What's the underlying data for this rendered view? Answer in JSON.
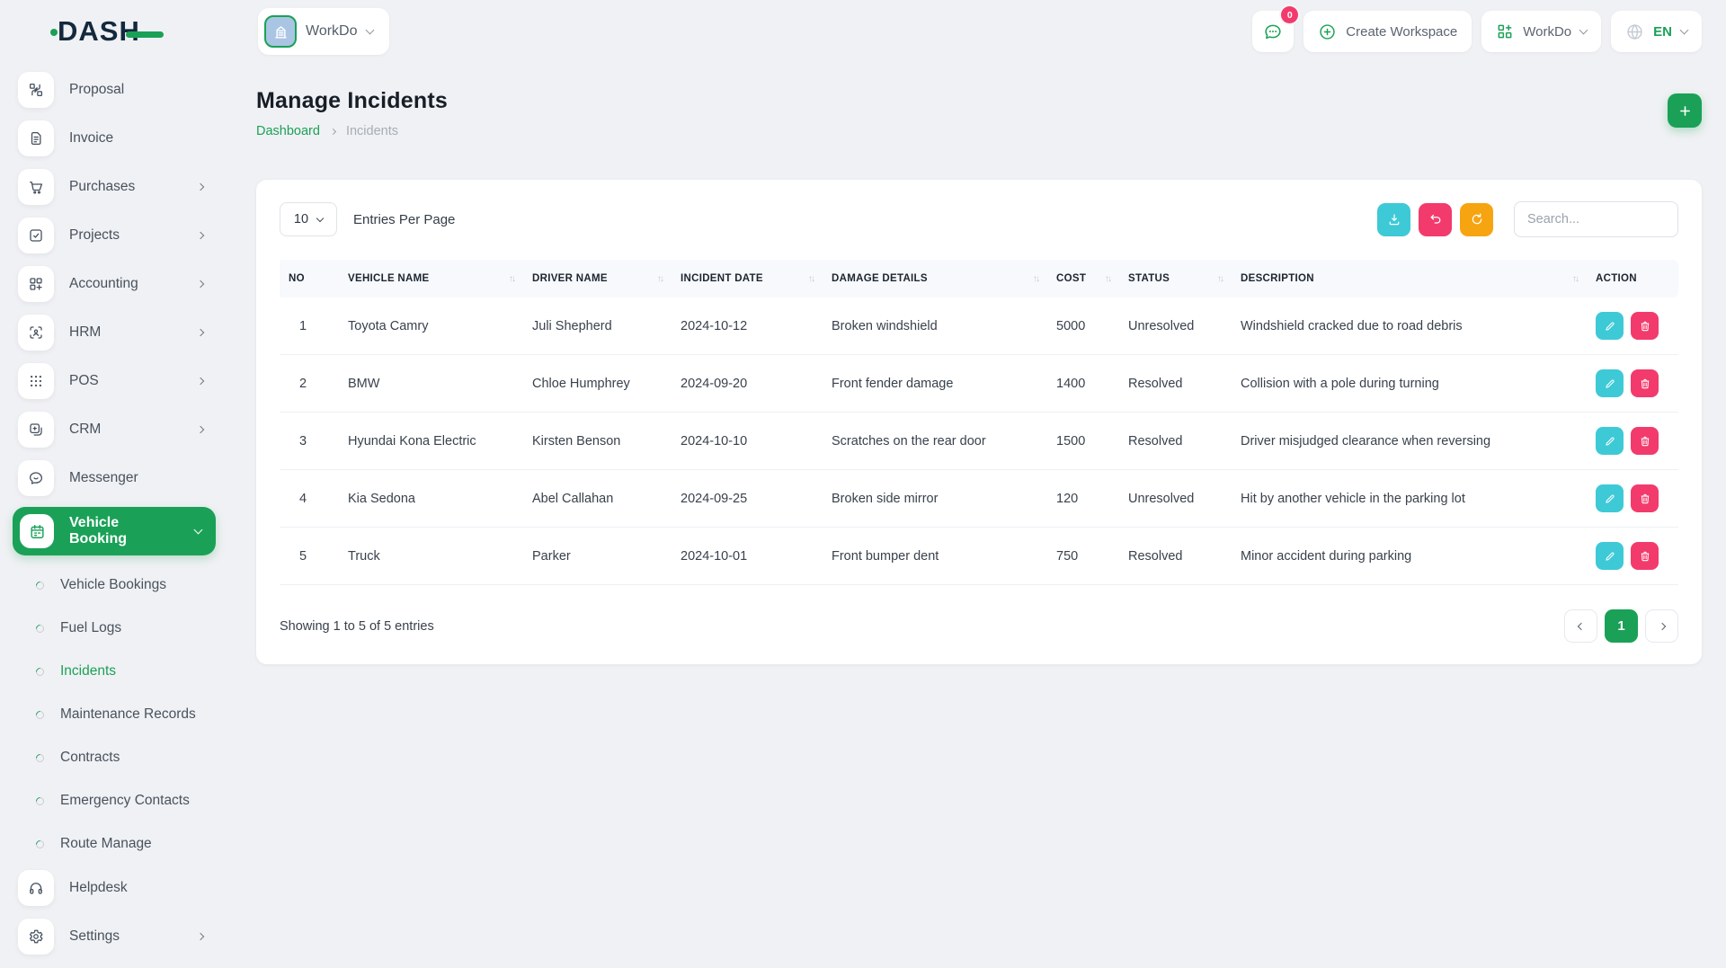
{
  "brand": {
    "name": "DASH"
  },
  "header": {
    "workspace_selector_label": "WorkDo",
    "messages_badge": "0",
    "create_workspace_label": "Create Workspace",
    "workspace_dropdown_label": "WorkDo",
    "language": "EN"
  },
  "sidebar": {
    "items": [
      {
        "label": "Proposal"
      },
      {
        "label": "Invoice"
      },
      {
        "label": "Purchases"
      },
      {
        "label": "Projects"
      },
      {
        "label": "Accounting"
      },
      {
        "label": "HRM"
      },
      {
        "label": "POS"
      },
      {
        "label": "CRM"
      },
      {
        "label": "Messenger"
      }
    ],
    "vehicle_booking_label": "Vehicle Booking",
    "submenu": [
      {
        "label": "Vehicle Bookings"
      },
      {
        "label": "Fuel Logs"
      },
      {
        "label": "Incidents",
        "active": true
      },
      {
        "label": "Maintenance Records"
      },
      {
        "label": "Contracts"
      },
      {
        "label": "Emergency Contacts"
      },
      {
        "label": "Route Manage"
      }
    ],
    "helpdesk_label": "Helpdesk",
    "settings_label": "Settings"
  },
  "page": {
    "title": "Manage Incidents",
    "breadcrumb_home": "Dashboard",
    "breadcrumb_current": "Incidents"
  },
  "toolbar": {
    "entries_per_page_value": "10",
    "entries_per_page_label": "Entries Per Page",
    "search_placeholder": "Search..."
  },
  "table": {
    "columns": [
      {
        "label": "NO",
        "sortable": false
      },
      {
        "label": "VEHICLE NAME",
        "sortable": true
      },
      {
        "label": "DRIVER NAME",
        "sortable": true
      },
      {
        "label": "INCIDENT DATE",
        "sortable": true
      },
      {
        "label": "DAMAGE DETAILS",
        "sortable": true
      },
      {
        "label": "COST",
        "sortable": true
      },
      {
        "label": "STATUS",
        "sortable": true
      },
      {
        "label": "DESCRIPTION",
        "sortable": true
      },
      {
        "label": "ACTION",
        "sortable": false
      }
    ],
    "rows": [
      {
        "no": "1",
        "vehicle": "Toyota Camry",
        "driver": "Juli Shepherd",
        "date": "2024-10-12",
        "damage": "Broken windshield",
        "cost": "5000",
        "status": "Unresolved",
        "description": "Windshield cracked due to road debris"
      },
      {
        "no": "2",
        "vehicle": "BMW",
        "driver": "Chloe Humphrey",
        "date": "2024-09-20",
        "damage": "Front fender damage",
        "cost": "1400",
        "status": "Resolved",
        "description": "Collision with a pole during turning"
      },
      {
        "no": "3",
        "vehicle": "Hyundai Kona Electric",
        "driver": "Kirsten Benson",
        "date": "2024-10-10",
        "damage": "Scratches on the rear door",
        "cost": "1500",
        "status": "Resolved",
        "description": "Driver misjudged clearance when reversing"
      },
      {
        "no": "4",
        "vehicle": "Kia Sedona",
        "driver": "Abel Callahan",
        "date": "2024-09-25",
        "damage": "Broken side mirror",
        "cost": "120",
        "status": "Unresolved",
        "description": "Hit by another vehicle in the parking lot"
      },
      {
        "no": "5",
        "vehicle": "Truck",
        "driver": "Parker",
        "date": "2024-10-01",
        "damage": "Front bumper dent",
        "cost": "750",
        "status": "Resolved",
        "description": "Minor accident during parking"
      }
    ]
  },
  "footer": {
    "showing_text": "Showing 1 to 5 of 5 entries",
    "current_page": "1"
  },
  "colors": {
    "primary_green": "#1aa157",
    "info_cyan": "#3ec9d6",
    "danger_pink": "#f23b6c",
    "warning_orange": "#f7a411"
  }
}
